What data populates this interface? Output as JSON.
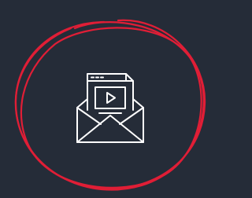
{
  "colors": {
    "background": "#252c38",
    "ring": "#e01e36",
    "icon": "#ffffff"
  },
  "icons": {
    "main": "email-video-icon",
    "decoration": "scribble-circle-icon"
  }
}
